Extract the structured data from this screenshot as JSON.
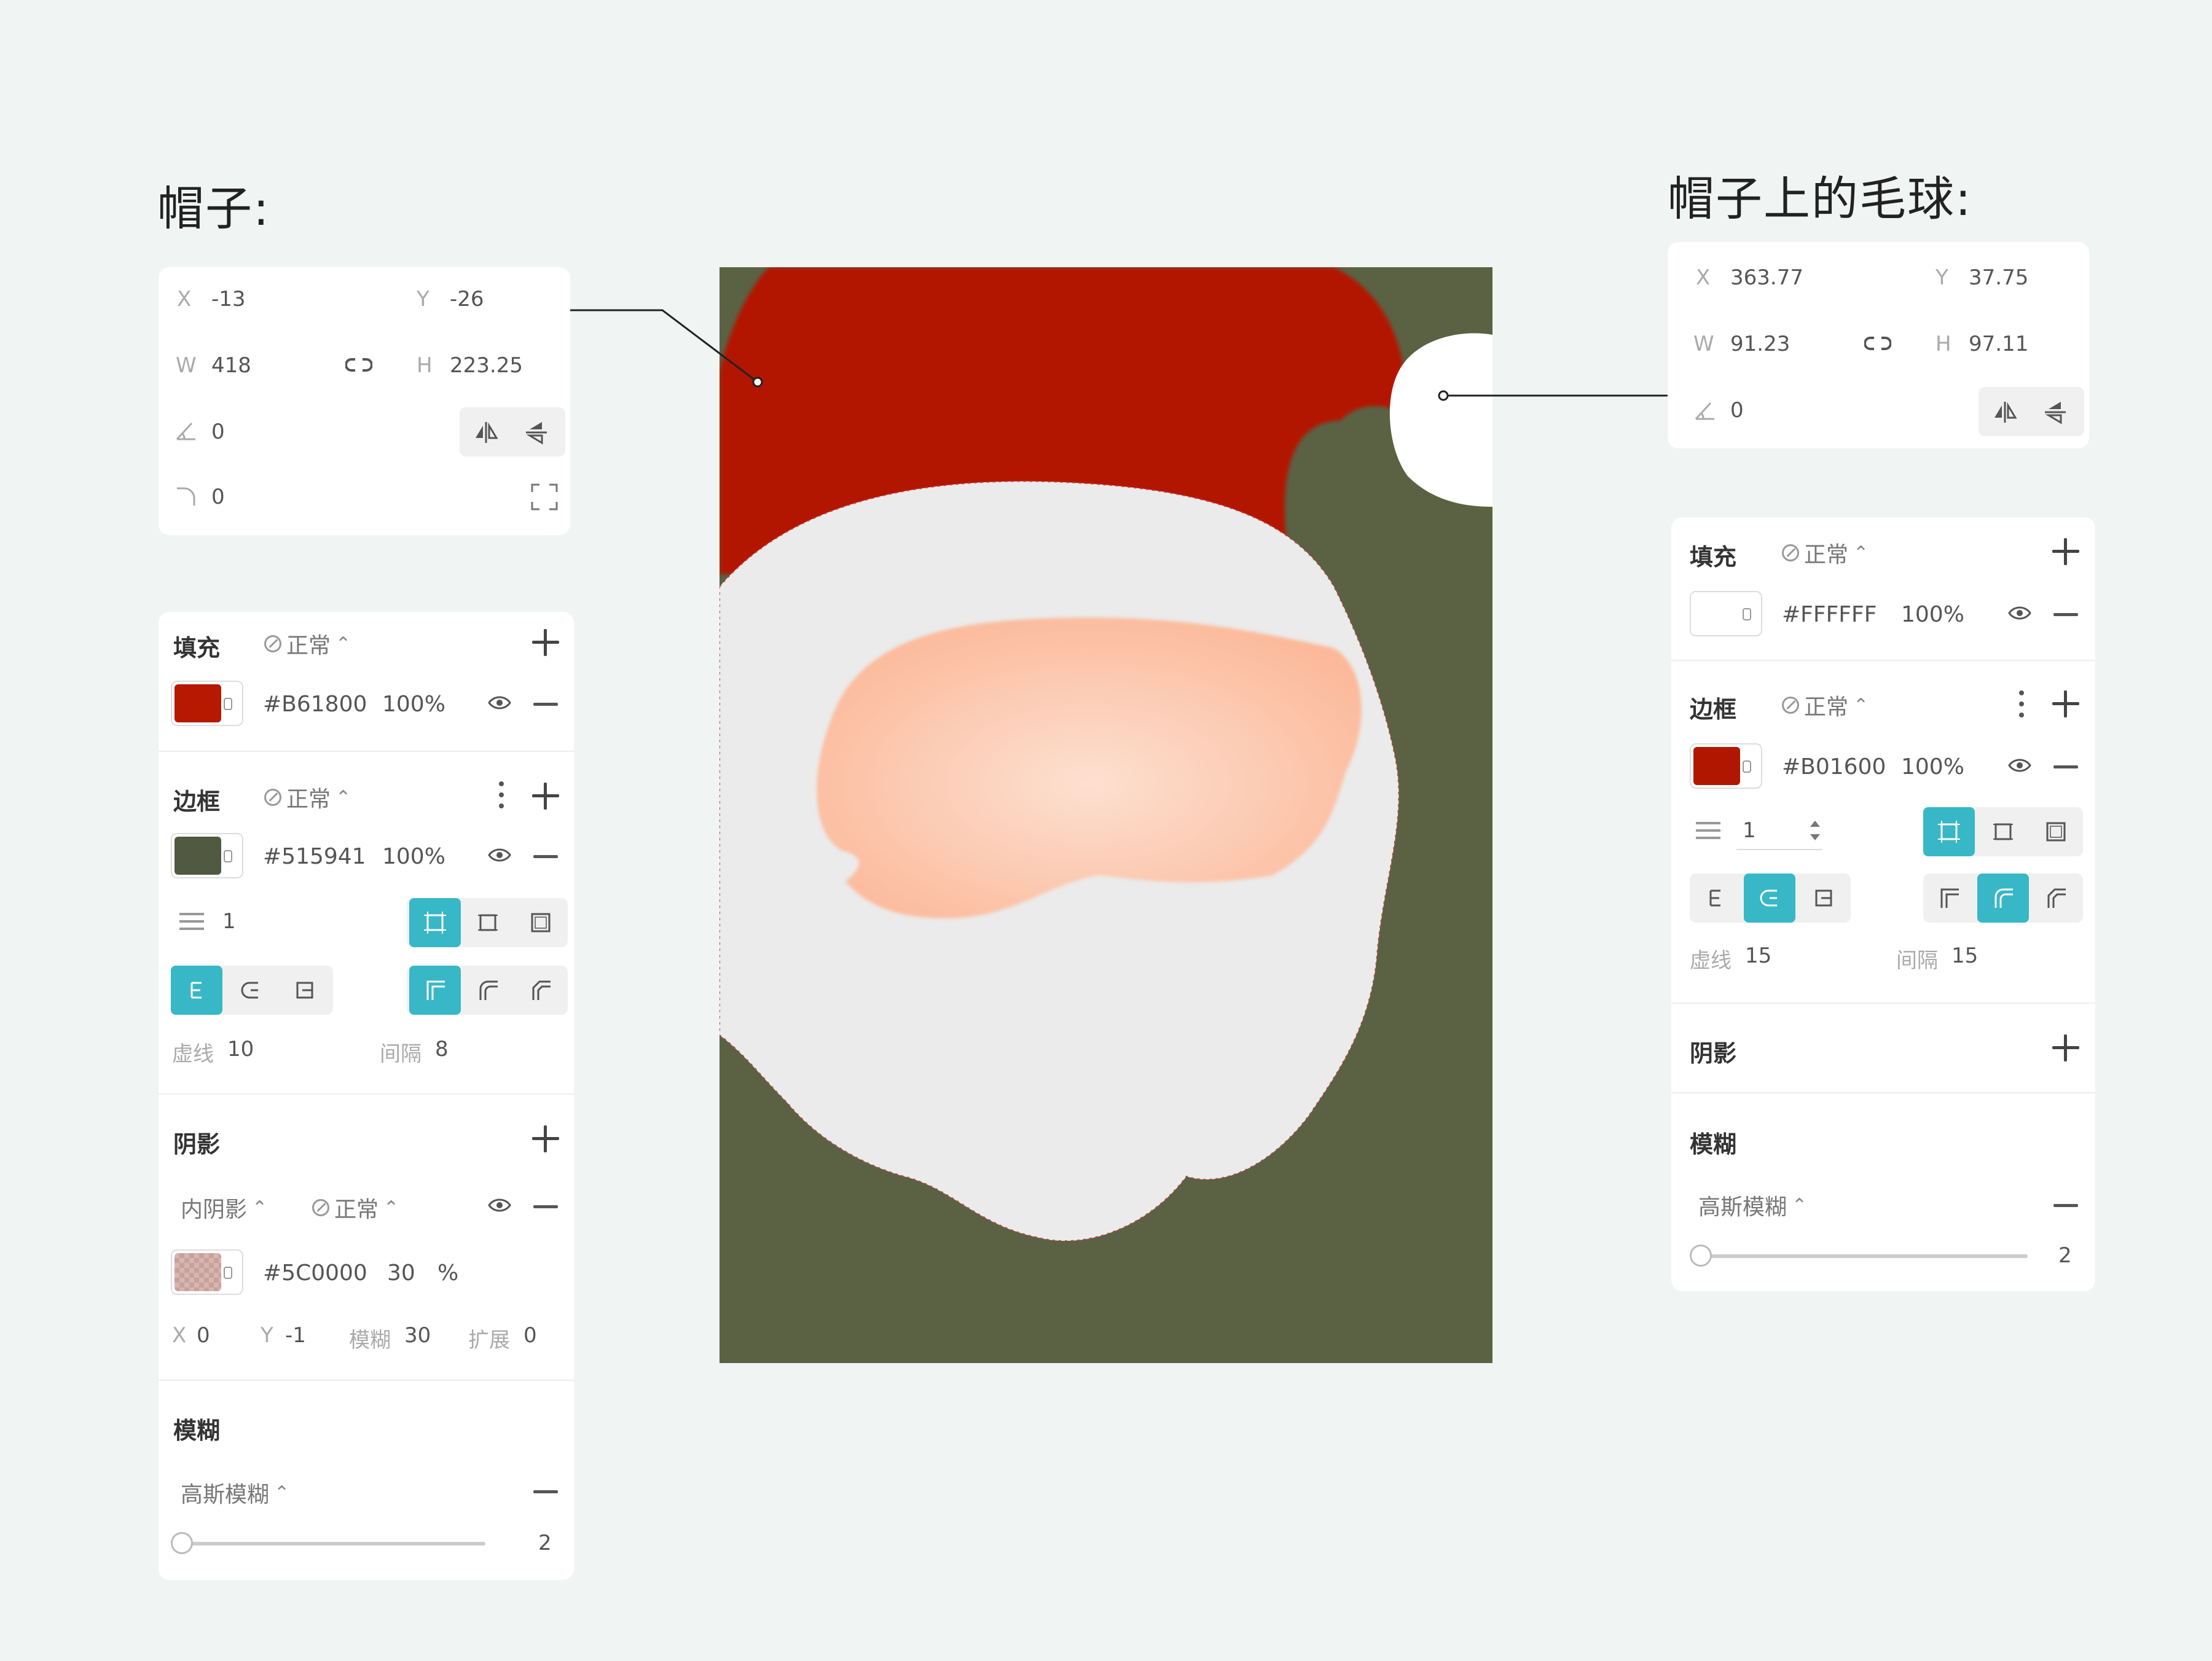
{
  "headings": {
    "hat": "帽子:",
    "pompom": "帽子上的毛球:"
  },
  "colors": {
    "hat_red": "#B61800",
    "border_green": "#515941",
    "background_green": "#5a6243",
    "fur_white": "#ebebeb",
    "face_skin": "#fcc9b0",
    "pompom_white": "#FFFFFF",
    "pompom_border": "#B01600",
    "accent_teal": "#38b7c6"
  },
  "left": {
    "transform": {
      "x_label": "X",
      "x": "-13",
      "y_label": "Y",
      "y": "-26",
      "w_label": "W",
      "w": "418",
      "h_label": "H",
      "h": "223.25",
      "angle": "0",
      "radius": "0"
    },
    "fill": {
      "title": "填充",
      "mode": "正常",
      "hex": "#B61800",
      "opacity": "100%"
    },
    "border": {
      "title": "边框",
      "mode": "正常",
      "hex": "#515941",
      "opacity": "100%",
      "width": "1",
      "dash_label": "虚线",
      "dash": "10",
      "gap_label": "间隔",
      "gap": "8"
    },
    "shadow": {
      "title": "阴影",
      "type": "内阴影",
      "mode": "正常",
      "hex": "#5C0000",
      "opacity": "30",
      "pct": "%",
      "x_label": "X",
      "x": "0",
      "y_label": "Y",
      "y": "-1",
      "blur_label": "模糊",
      "blur": "30",
      "spread_label": "扩展",
      "spread": "0"
    },
    "blur": {
      "title": "模糊",
      "type": "高斯模糊",
      "value": "2",
      "level": 0
    }
  },
  "right": {
    "transform": {
      "x_label": "X",
      "x": "363.77",
      "y_label": "Y",
      "y": "37.75",
      "w_label": "W",
      "w": "91.23",
      "h_label": "H",
      "h": "97.11",
      "angle": "0"
    },
    "fill": {
      "title": "填充",
      "mode": "正常",
      "hex": "#FFFFFF",
      "opacity": "100%"
    },
    "border": {
      "title": "边框",
      "mode": "正常",
      "hex": "#B01600",
      "opacity": "100%",
      "width": "1",
      "dash_label": "虚线",
      "dash": "15",
      "gap_label": "间隔",
      "gap": "15"
    },
    "shadow": {
      "title": "阴影"
    },
    "blur": {
      "title": "模糊",
      "type": "高斯模糊",
      "value": "2",
      "level": 0
    }
  }
}
